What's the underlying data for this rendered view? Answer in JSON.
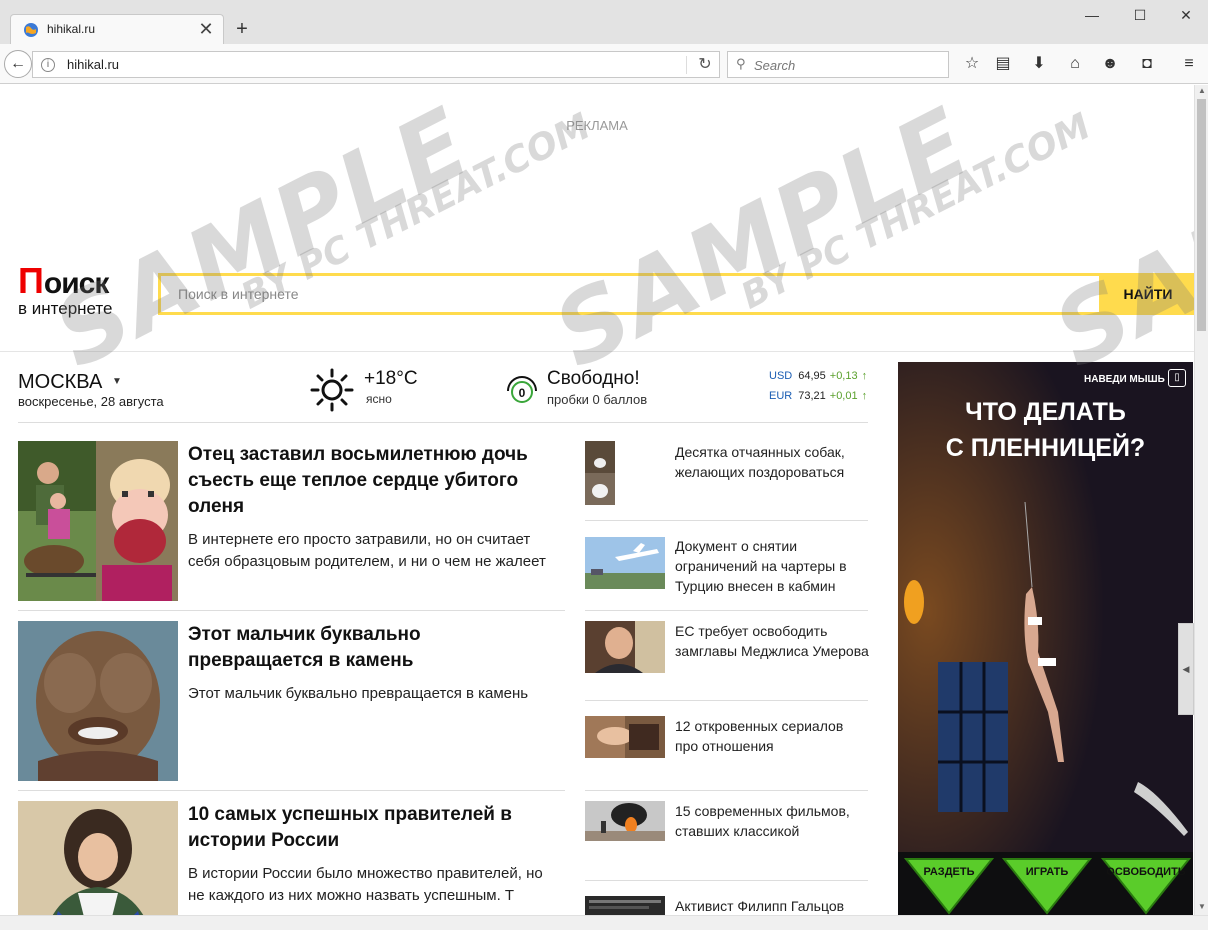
{
  "browser": {
    "tab_title": "hihikal.ru",
    "tab_close": "✕",
    "new_tab": "+",
    "url": "hihikal.ru",
    "search_placeholder": "Search",
    "minimize": "—",
    "maximize": "☐",
    "close": "✕",
    "toolbar_icons": [
      "star-icon",
      "reading-list-icon",
      "download-icon",
      "home-icon",
      "smiley-icon",
      "pocket-icon",
      "menu-icon"
    ]
  },
  "page": {
    "ad_label": "РЕКЛАМА",
    "logo": {
      "first_letter": "П",
      "rest": "оиск",
      "sub": "в интернете",
      "accent_color": "#e00000"
    },
    "search": {
      "placeholder": "Поиск в интернете",
      "button": "НАЙТИ",
      "accent_color": "#ffdb4d"
    },
    "location": {
      "city": "МОСКВА",
      "date": "воскресенье, 28 августа"
    },
    "weather": {
      "temp": "+18°C",
      "desc": "ясно",
      "icon": "sun-icon"
    },
    "traffic": {
      "level": "0",
      "status": "Свободно!",
      "desc": "пробки 0 баллов",
      "icon": "traffic-gauge-icon"
    },
    "rates": [
      {
        "code": "USD",
        "value": "64,95",
        "change": "+0,13",
        "arrow": "↑"
      },
      {
        "code": "EUR",
        "value": "73,21",
        "change": "+0,01",
        "arrow": "↑"
      }
    ],
    "main_articles": [
      {
        "title": "Отец заставил восьмилетнюю дочь съесть еще теплое сердце убитого оленя",
        "desc": "В интернете его просто затравили, но он считает себя образцовым родителем, и ни о чем не жалеет"
      },
      {
        "title": "Этот мальчик буквально превращается в камень",
        "desc": "Этот мальчик буквально превращается в камень"
      },
      {
        "title": "10 самых успешных правителей в истории России",
        "desc": "В истории России было множество правителей, но не каждого из них можно назвать успешным. Т"
      }
    ],
    "side_articles": [
      {
        "title": "Десятка отчаянных собак, желающих поздороваться"
      },
      {
        "title": "Документ о снятии ограничений на чартеры в Турцию внесен в кабмин"
      },
      {
        "title": "ЕС требует освободить замглавы Меджлиса Умерова"
      },
      {
        "title": "12 откровенных сериалов про отношения"
      },
      {
        "title": "15 современных фильмов, ставших классикой"
      },
      {
        "title": "Активист Филипп Гальцов"
      }
    ],
    "ad_banner": {
      "hint": "НАВЕДИ МЫШЬ",
      "headline_line1": "ЧТО ДЕЛАТЬ",
      "headline_line2": "С ПЛЕННИЦЕЙ?",
      "buttons": [
        "РАЗДЕТЬ",
        "ИГРАТЬ",
        "ОСВОБОДИТЬ"
      ]
    },
    "watermark": {
      "big": "SAMPLE",
      "small": "BY PC THREAT.COM"
    }
  }
}
